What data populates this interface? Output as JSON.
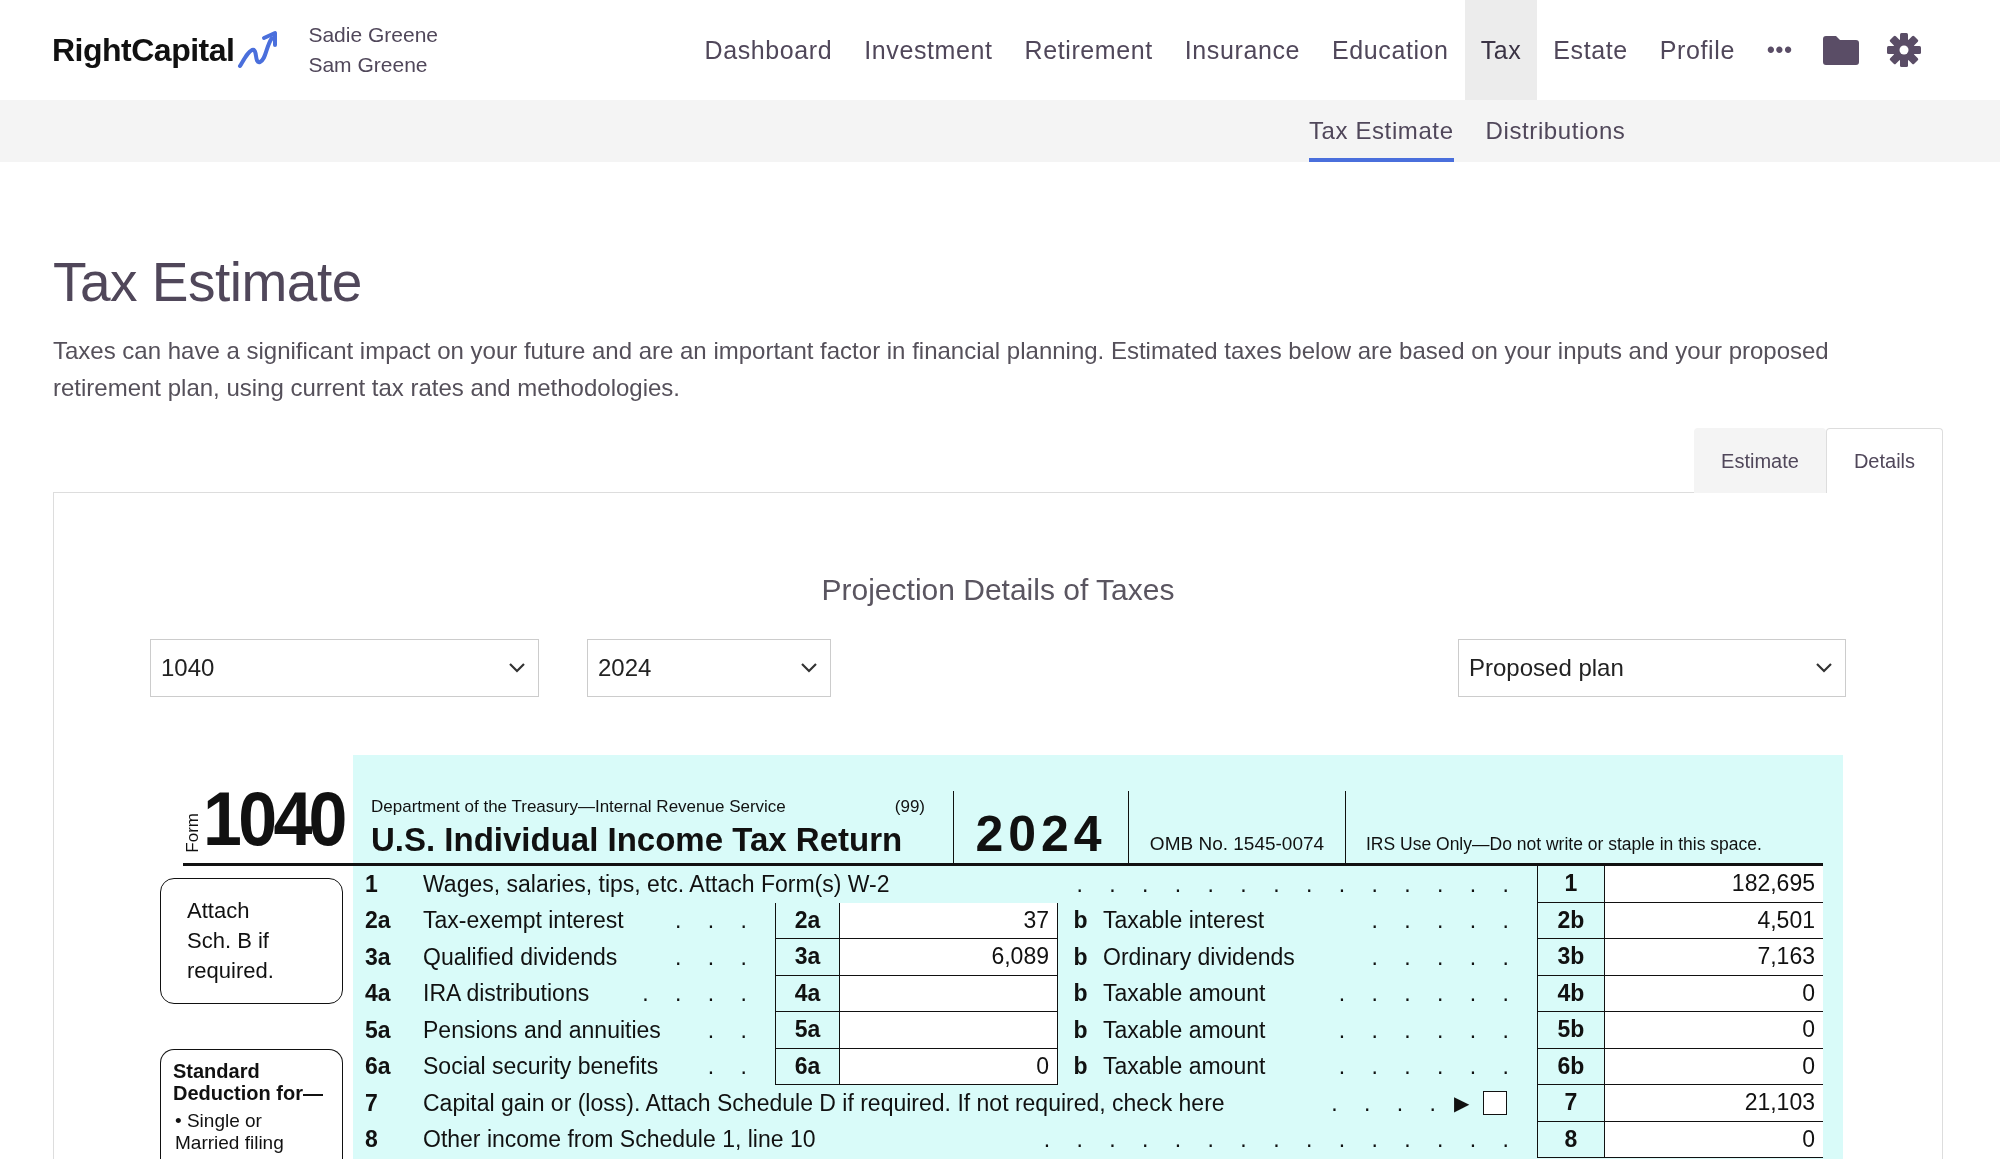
{
  "header": {
    "logo": "RightCapital",
    "clients": [
      "Sadie Greene",
      "Sam Greene"
    ],
    "nav": [
      {
        "label": "Dashboard",
        "selected": false
      },
      {
        "label": "Investment",
        "selected": false
      },
      {
        "label": "Retirement",
        "selected": false
      },
      {
        "label": "Insurance",
        "selected": false
      },
      {
        "label": "Education",
        "selected": false
      },
      {
        "label": "Tax",
        "selected": true
      },
      {
        "label": "Estate",
        "selected": false
      },
      {
        "label": "Profile",
        "selected": false
      }
    ],
    "more": "•••"
  },
  "subnav": [
    {
      "label": "Tax Estimate",
      "selected": true
    },
    {
      "label": "Distributions",
      "selected": false
    }
  ],
  "page": {
    "title": "Tax Estimate",
    "description": "Taxes can have a significant impact on your future and are an important factor in financial planning. Estimated taxes below are based on your inputs and your proposed retirement plan, using current tax rates and methodologies."
  },
  "view_tabs": [
    {
      "label": "Estimate",
      "selected": false
    },
    {
      "label": "Details",
      "selected": true
    }
  ],
  "panel": {
    "heading": "Projection Details of Taxes",
    "dropdowns": [
      {
        "value": "1040"
      },
      {
        "value": "2024"
      },
      {
        "value": "Proposed plan"
      }
    ]
  },
  "form": {
    "form_label": "Form",
    "form_number": "1040",
    "agency": "Department of the Treasury—Internal Revenue Service",
    "code": "(99)",
    "title": "U.S. Individual Income Tax Return",
    "year": "2024",
    "omb": "OMB No. 1545-0074",
    "irs_use": "IRS Use Only—Do not write or staple in this space.",
    "callouts": [
      {
        "kind": "note",
        "text": "Attach Sch. B if required."
      },
      {
        "kind": "deduction",
        "heading": "Standard Deduction for—",
        "items": [
          "• Single or Married filing"
        ]
      }
    ],
    "lines": [
      {
        "kind": "full",
        "num": "1",
        "label": "Wages, salaries, tips, etc. Attach Form(s) W-2",
        "leader": ". . . . . . . . . . . . . .",
        "code": "1",
        "value": "182,695"
      },
      {
        "kind": "pair",
        "num": "2a",
        "label": "Tax-exempt interest",
        "leader": ". . .",
        "code_a": "2a",
        "value_a": "37",
        "b": "b",
        "label_b": "Taxable interest",
        "leader_b": ". . . . .",
        "code_b": "2b",
        "value_b": "4,501"
      },
      {
        "kind": "pair",
        "num": "3a",
        "label": "Qualified dividends",
        "leader": ". . .",
        "code_a": "3a",
        "value_a": "6,089",
        "b": "b",
        "label_b": "Ordinary dividends",
        "leader_b": ". . . . .",
        "code_b": "3b",
        "value_b": "7,163"
      },
      {
        "kind": "pair",
        "num": "4a",
        "label": "IRA distributions",
        "leader": ". . . .",
        "code_a": "4a",
        "b": "b",
        "label_b": "Taxable amount",
        "leader_b": ". . . . . .",
        "code_b": "4b",
        "value_b": "0"
      },
      {
        "kind": "pair",
        "num": "5a",
        "label": "Pensions and annuities",
        "leader": ". .",
        "code_a": "5a",
        "b": "b",
        "label_b": "Taxable amount",
        "leader_b": ". . . . . .",
        "code_b": "5b",
        "value_b": "0"
      },
      {
        "kind": "pair",
        "num": "6a",
        "label": "Social security benefits",
        "leader": ". .",
        "code_a": "6a",
        "value_a": "0",
        "b": "b",
        "label_b": "Taxable amount",
        "leader_b": ". . . . . .",
        "code_b": "6b",
        "value_b": "0"
      },
      {
        "kind": "check",
        "num": "7",
        "label": "Capital gain or (loss). Attach Schedule D if required. If not required, check here",
        "leader": ". . . .",
        "arrow": "▶",
        "checked": false,
        "code": "7",
        "value": "21,103"
      },
      {
        "kind": "full",
        "num": "8",
        "label": "Other income from Schedule 1, line 10",
        "leader": ". . . . . . . . . . . . . . .",
        "code": "8",
        "value": "0"
      }
    ]
  }
}
